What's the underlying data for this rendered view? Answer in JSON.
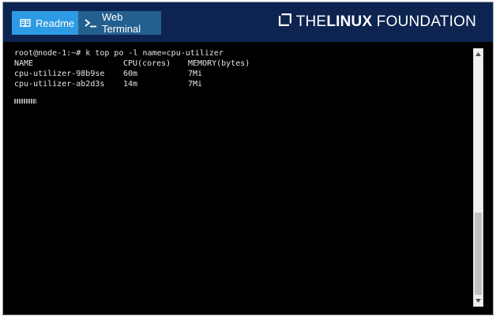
{
  "header": {
    "tabs": [
      {
        "label": "Readme",
        "icon": "book-icon"
      },
      {
        "label": "Web Terminal",
        "icon": "terminal-prompt-icon"
      }
    ],
    "brand": {
      "the": "THE",
      "linux": "LINUX",
      "foundation": "FOUNDATION",
      "icon": "linux-foundation-logo-icon"
    }
  },
  "terminal": {
    "command_line": "root@node-1:~# k top po -l name=cpu-utilizer",
    "table": {
      "columns": [
        "NAME",
        "CPU(cores)",
        "MEMORY(bytes)"
      ],
      "rows": [
        [
          "cpu-utilizer-98b9se",
          "60m",
          "7Mi"
        ],
        [
          "cpu-utilizer-ab2d3s",
          "14m",
          "7Mi"
        ]
      ]
    }
  },
  "colors": {
    "header_bg": "#0d2350",
    "readme_tab": "#2d9be3",
    "terminal_tab": "#24608f",
    "terminal_bg": "#000000",
    "terminal_text": "#e6e6e6"
  }
}
